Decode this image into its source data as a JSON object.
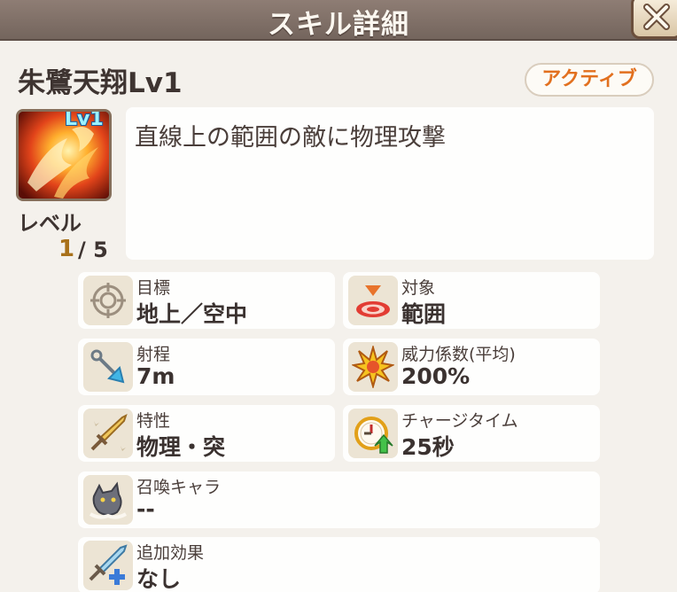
{
  "window": {
    "title": "スキル詳細",
    "close_icon": "close-x-icon"
  },
  "skill": {
    "name": "朱鷺天翔Lv1",
    "type": "アクティブ",
    "icon_level": "Lv1",
    "description": "直線上の範囲の敵に物理攻撃",
    "level_label": "レベル",
    "level_current": "1",
    "level_max": "/ 5"
  },
  "stats": {
    "target": {
      "label": "目標",
      "value": "地上／空中",
      "icon": "crosshair-icon"
    },
    "scope": {
      "label": "対象",
      "value": "範囲",
      "icon": "area-target-icon"
    },
    "range": {
      "label": "射程",
      "value": "7m",
      "icon": "arrow-icon"
    },
    "power": {
      "label": "威力係数(平均)",
      "value": "200%",
      "icon": "burst-icon"
    },
    "attribute": {
      "label": "特性",
      "value": "物理・突",
      "icon": "sword-icon"
    },
    "charge": {
      "label": "チャージタイム",
      "value": "25秒",
      "icon": "clock-icon"
    },
    "summon": {
      "label": "召喚キャラ",
      "value": "--",
      "icon": "summon-creature-icon"
    },
    "extra": {
      "label": "追加効果",
      "value": "なし",
      "icon": "sword-plus-icon"
    }
  },
  "colors": {
    "title_bar": "#7f6f66",
    "badge_text": "#e2701f",
    "level_value": "#a8711a",
    "icon_level_text": "#9df2ff"
  }
}
